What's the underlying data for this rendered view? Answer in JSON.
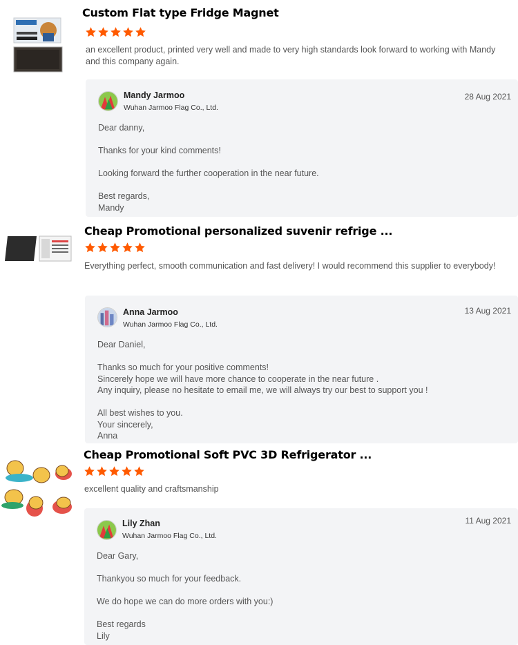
{
  "colors": {
    "star": "#ff5a00",
    "reply_bg": "#f3f4f6"
  },
  "reviews": [
    {
      "product_title": "Custom Flat type Fridge Magnet",
      "rating": 5,
      "comment": "an excellent product, printed very well and made to very high standards look forward to working with Mandy and this company again.",
      "reply": {
        "name": "Mandy Jarmoo",
        "company": "Wuhan Jarmoo Flag Co., Ltd.",
        "date": "28 Aug 2021",
        "lines": [
          "Dear danny,",
          "",
          "Thanks for your kind comments!",
          "",
          "Looking forward the further cooperation in the near future.",
          "",
          "Best regards,",
          "Mandy"
        ]
      }
    },
    {
      "product_title": "Cheap Promotional personalized suvenir refrige ...",
      "rating": 5,
      "comment": "Everything perfect, smooth communication and fast delivery! I would recommend this supplier to everybody!",
      "reply": {
        "name": "Anna Jarmoo",
        "company": "Wuhan Jarmoo Flag Co., Ltd.",
        "date": "13 Aug 2021",
        "lines": [
          "Dear Daniel,",
          "",
          "Thanks so much for your positive comments!",
          "Sincerely hope we will have more chance to cooperate in the near future .",
          "Any inquiry,  please no hesitate to email me,  we will always try our best to support you !",
          "",
          "All best wishes to you.",
          "Your sincerely,",
          "Anna"
        ]
      }
    },
    {
      "product_title": "Cheap Promotional Soft PVC 3D Refrigerator ...",
      "rating": 5,
      "comment": "excellent quality and craftsmanship",
      "reply": {
        "name": "Lily Zhan",
        "company": "Wuhan Jarmoo Flag Co., Ltd.",
        "date": "11 Aug 2021",
        "lines": [
          "Dear Gary,",
          "",
          "Thankyou so much for your  feedback.",
          "",
          "We do hope we can do more orders with you:)",
          "",
          "Best regards",
          "Lily"
        ]
      }
    }
  ]
}
